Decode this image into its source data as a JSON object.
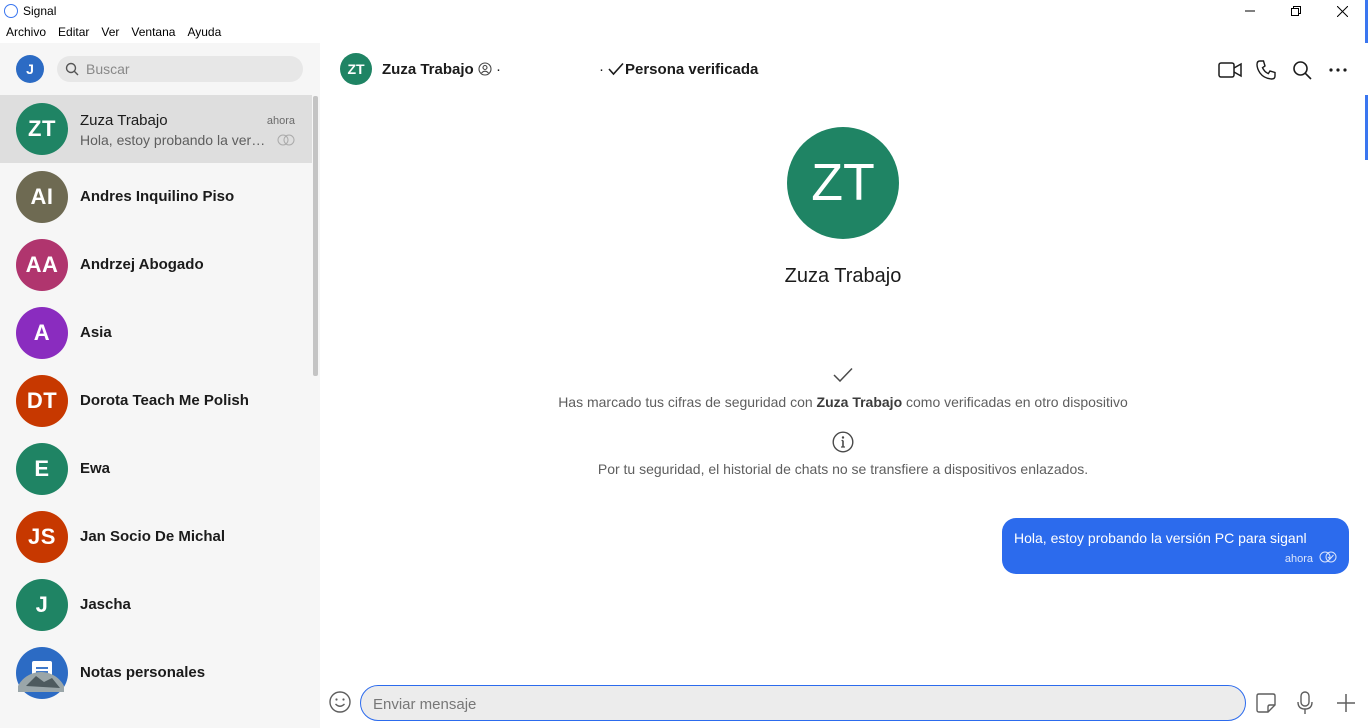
{
  "window": {
    "title": "Signal",
    "controls": {
      "minimize_icon": "minimize-icon",
      "maximize_icon": "restore-icon",
      "close_icon": "close-icon"
    }
  },
  "menu": [
    "Archivo",
    "Editar",
    "Ver",
    "Ventana",
    "Ayuda"
  ],
  "sidebar": {
    "my_avatar": "J",
    "search_placeholder": "Buscar",
    "conversations": [
      {
        "initials": "ZT",
        "name": "Zuza Trabajo",
        "time": "ahora",
        "preview": "Hola, estoy probando la versión PC para siganl",
        "color": "#1f8464",
        "active": true
      },
      {
        "initials": "AI",
        "name": "Andres Inquilino Piso",
        "color": "#6e6a52"
      },
      {
        "initials": "AA",
        "name": "Andrzej Abogado",
        "color": "#b0356e"
      },
      {
        "initials": "A",
        "name": "Asia",
        "color": "#8a2cbf"
      },
      {
        "initials": "DT",
        "name": "Dorota Teach Me Polish",
        "color": "#c73800"
      },
      {
        "initials": "E",
        "name": "Ewa",
        "color": "#1f8464"
      },
      {
        "initials": "JS",
        "name": "Jan Socio De Michal",
        "color": "#c73800"
      },
      {
        "initials": "J",
        "name": "Jascha",
        "color": "#1f8464"
      },
      {
        "initials": "",
        "icon": "note-icon",
        "name": "Notas personales",
        "color": "#2c6bc4"
      }
    ]
  },
  "header": {
    "avatar": "ZT",
    "name": "Zuza Trabajo",
    "separator_left": "·",
    "separator_right": "·",
    "verified": "Persona verificada",
    "buttons": [
      "video-call-icon",
      "phone-icon",
      "search-icon",
      "more-icon"
    ]
  },
  "conversation": {
    "hero_initials": "ZT",
    "hero_name": "Zuza Trabajo",
    "verified_notice": {
      "before": "Has marcado tus cifras de seguridad con ",
      "name": "Zuza Trabajo",
      "after": " como verificadas en otro dispositivo"
    },
    "history_notice": "Por tu seguridad, el historial de chats no se transfiere a dispositivos enlazados.",
    "messages": [
      {
        "text": "Hola, estoy probando la versión PC para siganl",
        "time": "ahora",
        "outgoing": true,
        "status": "read"
      }
    ]
  },
  "composer": {
    "placeholder": "Enviar mensaje",
    "buttons": [
      "emoji-icon",
      "sticker-icon",
      "microphone-icon",
      "attach-icon"
    ]
  },
  "colors": {
    "accent": "#2c6bed",
    "sidebar_bg": "#f6f6f6",
    "active_row": "#dedede"
  }
}
